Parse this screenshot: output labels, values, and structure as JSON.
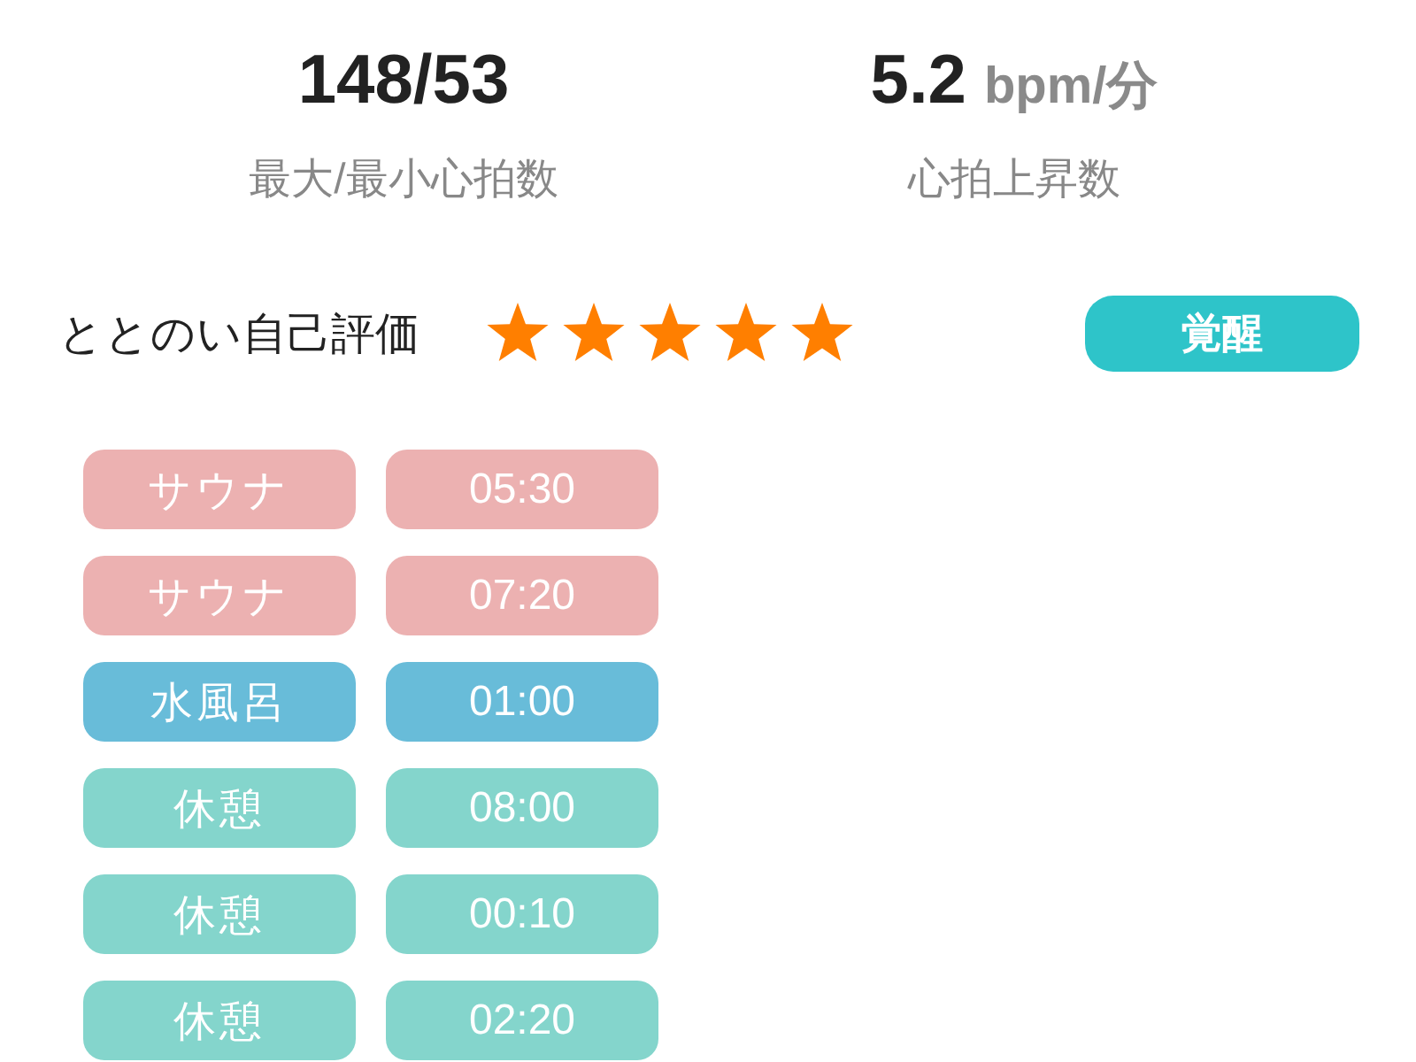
{
  "stats": [
    {
      "value": "148/53",
      "label": "最大/最小心拍数"
    },
    {
      "value": "5.2",
      "unit": "bpm/分",
      "label": "心拍上昇数"
    }
  ],
  "rating": {
    "label": "ととのい自己評価",
    "stars": 5,
    "tag": "覚醒"
  },
  "sessions": [
    {
      "name": "サウナ",
      "duration": "05:30",
      "color": "#ecb1b1"
    },
    {
      "name": "サウナ",
      "duration": "07:20",
      "color": "#ecb1b1"
    },
    {
      "name": "水風呂",
      "duration": "01:00",
      "color": "#68bcd9"
    },
    {
      "name": "休憩",
      "duration": "08:00",
      "color": "#84d5cc"
    },
    {
      "name": "休憩",
      "duration": "00:10",
      "color": "#84d5cc"
    },
    {
      "name": "休憩",
      "duration": "02:20",
      "color": "#84d5cc"
    }
  ]
}
